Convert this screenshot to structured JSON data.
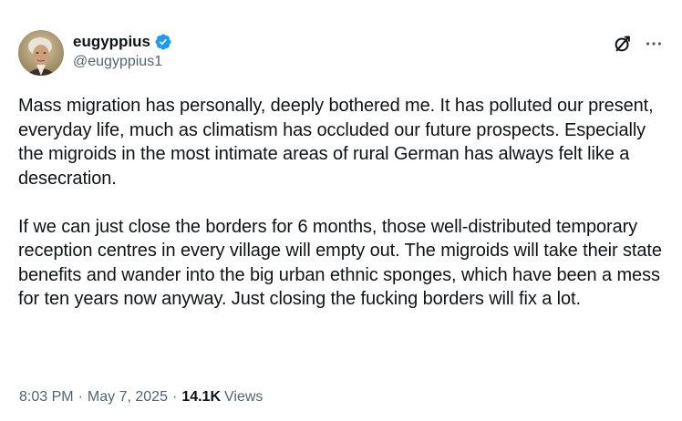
{
  "author": {
    "display_name": "eugyppius",
    "handle": "@eugyppius1",
    "verified": true,
    "verified_color": "#1d9bf0"
  },
  "icons": {
    "avatar": "avatar-portrait",
    "verified": "verified-badge-icon",
    "grok": "grok-icon",
    "more": "more-options-icon"
  },
  "tweet": {
    "paragraphs": [
      "Mass migration has personally, deeply bothered me. It has polluted our present, everyday life, much as climatism has occluded our future prospects. Especially the migroids in the most intimate areas of rural German has always felt like a desecration.",
      "If we can just close the borders for 6 months, those well-distributed temporary reception centres in every village will empty out. The migroids will take their state benefits and wander into the big urban ethnic sponges, which have been a mess for ten years now anyway. Just closing the fucking borders will fix a lot."
    ]
  },
  "meta": {
    "time": "8:03 PM",
    "separator": "·",
    "date": "May 7, 2025",
    "views_count": "14.1K",
    "views_label": "Views"
  },
  "colors": {
    "text": "#0f1419",
    "secondary": "#536471",
    "accent": "#1d9bf0",
    "background": "#ffffff"
  }
}
